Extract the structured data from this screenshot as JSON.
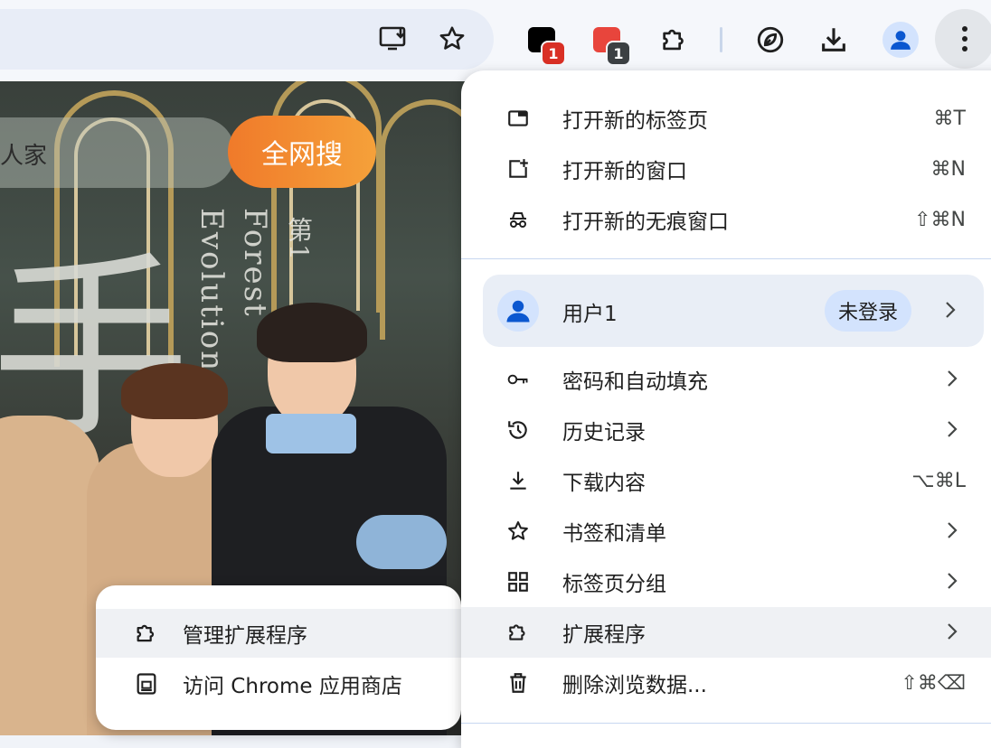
{
  "toolbar": {
    "icons": [
      "install-app-icon",
      "bookmark-star-icon",
      "extension-puzzle-icon",
      "performance-leaf-icon",
      "download-icon",
      "profile-avatar-icon",
      "more-menu-icon"
    ],
    "extensions": [
      {
        "badge": "1",
        "badge_color": "#d93025",
        "tile_color": "#000000"
      },
      {
        "badge": "1",
        "badge_color": "#3c4043",
        "tile_color": "#e8453c"
      }
    ]
  },
  "page": {
    "search_partial_text": "人家",
    "search_button": "全网搜",
    "vertical_text_1": "Evolution",
    "vertical_text_2": "Forest",
    "vertical_text_3": "第1",
    "big_glyph": "手"
  },
  "menu": {
    "items_top": [
      {
        "label": "打开新的标签页",
        "shortcut": "⌘T",
        "icon": "new-tab-icon"
      },
      {
        "label": "打开新的窗口",
        "shortcut": "⌘N",
        "icon": "new-window-icon"
      },
      {
        "label": "打开新的无痕窗口",
        "shortcut": "⇧⌘N",
        "icon": "incognito-icon"
      }
    ],
    "profile": {
      "name": "用户1",
      "status": "未登录"
    },
    "items_bottom": [
      {
        "label": "密码和自动填充",
        "shortcut": "",
        "icon": "key-icon",
        "submenu": true
      },
      {
        "label": "历史记录",
        "shortcut": "",
        "icon": "history-icon",
        "submenu": true
      },
      {
        "label": "下载内容",
        "shortcut": "⌥⌘L",
        "icon": "download-icon",
        "submenu": false
      },
      {
        "label": "书签和清单",
        "shortcut": "",
        "icon": "star-icon",
        "submenu": true
      },
      {
        "label": "标签页分组",
        "shortcut": "",
        "icon": "tab-groups-icon",
        "submenu": true
      },
      {
        "label": "扩展程序",
        "shortcut": "",
        "icon": "extension-puzzle-icon",
        "submenu": true
      },
      {
        "label": "删除浏览数据...",
        "shortcut": "⇧⌘⌫",
        "icon": "trash-icon",
        "submenu": false
      }
    ]
  },
  "extensions_submenu": {
    "items": [
      {
        "label": "管理扩展程序",
        "icon": "extension-puzzle-icon"
      },
      {
        "label": "访问 Chrome 应用商店",
        "icon": "web-store-icon"
      }
    ]
  },
  "colors": {
    "accent_blue": "#0b57d0",
    "menu_bg": "#ffffff",
    "hover": "#eff1f4",
    "profile_bg": "#e9eef6",
    "search_button": "#f07a2a"
  }
}
